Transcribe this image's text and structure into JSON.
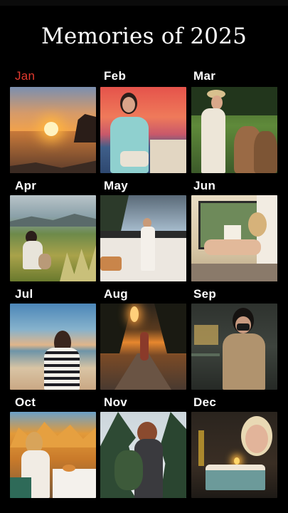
{
  "title": "Memories of 2025",
  "months": [
    "Jan",
    "Feb",
    "Mar",
    "Apr",
    "May",
    "Jun",
    "Jul",
    "Aug",
    "Sep",
    "Oct",
    "Nov",
    "Dec"
  ],
  "active_month": "Jan",
  "colors": {
    "background": "#000000",
    "active_month": "#e53a2f",
    "month_label": "#ffffff"
  }
}
